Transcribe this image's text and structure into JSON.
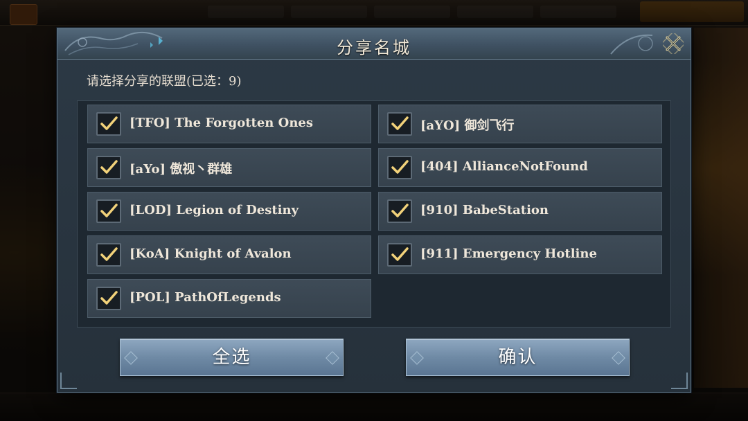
{
  "dialog": {
    "title": "分享名城",
    "subtitle": "请选择分享的联盟(已选：9)",
    "close_icon": "close-icon"
  },
  "alliances": [
    {
      "label": "[TFO] The Forgotten Ones",
      "checked": true
    },
    {
      "label": "[aYO] 御剑飞行",
      "checked": true
    },
    {
      "label": "[aYo] 傲视丶群雄",
      "checked": true
    },
    {
      "label": "[404] AllianceNotFound",
      "checked": true
    },
    {
      "label": "[LOD] Legion of Destiny",
      "checked": true
    },
    {
      "label": "[910] BabeStation",
      "checked": true
    },
    {
      "label": "[KoA] Knight of Avalon",
      "checked": true
    },
    {
      "label": "[911] Emergency Hotline",
      "checked": true
    },
    {
      "label": "[POL] PathOfLegends",
      "checked": true
    }
  ],
  "buttons": {
    "select_all": "全选",
    "confirm": "确认"
  },
  "colors": {
    "check_mark": "#f2d27a",
    "button": "#7b94ae",
    "panel": "#2a3640"
  }
}
